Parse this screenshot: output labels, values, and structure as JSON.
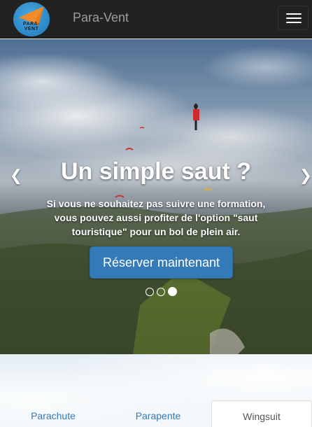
{
  "navbar": {
    "logo_text": "PARA-VENT",
    "brand": "Para-Vent"
  },
  "icons": {
    "logo": "paraglider-logo",
    "menu": "hamburger-icon",
    "prev": "chevron-left-icon",
    "next": "chevron-right-icon"
  },
  "hero": {
    "title": "Un simple saut ?",
    "text": "Si vous ne souhaitez pas suivre une formation, vous pouvez aussi profiter de l'option \"saut touristique\" pour un bol de plein air.",
    "cta": "Réserver maintenant",
    "slides_count": 3,
    "active_slide": 3
  },
  "tabs": [
    {
      "label": "Parachute",
      "active": false
    },
    {
      "label": "Parapente",
      "active": false
    },
    {
      "label": "Wingsuit",
      "active": true
    }
  ],
  "colors": {
    "navbar_bg": "#222222",
    "brand_text": "#9d9d9d",
    "primary": "#337ab7",
    "logo_orange": "#f28c28"
  }
}
